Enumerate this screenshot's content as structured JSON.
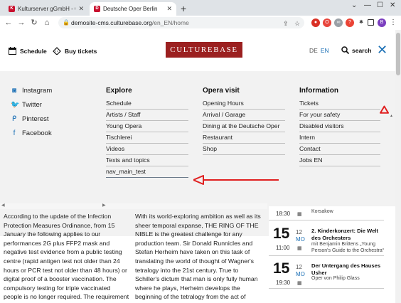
{
  "browser": {
    "tabs": [
      {
        "title": "Kulturserver gGmbH - Culturebas",
        "active": false
      },
      {
        "title": "Deutsche Oper Berlin",
        "active": true
      }
    ],
    "url_host": "demosite-cms.culturebase.org",
    "url_path": "/en_EN/home",
    "profile_initial": "B"
  },
  "header": {
    "schedule": "Schedule",
    "buy_tickets": "Buy tickets",
    "logo": "CULTUREBASE",
    "lang_de": "DE",
    "lang_en": "EN",
    "search": "search"
  },
  "menu": {
    "social": [
      "Instagram",
      "Twitter",
      "Pinterest",
      "Facebook"
    ],
    "explore": {
      "title": "Explore",
      "items": [
        "Schedule",
        "Artists / Staff",
        "Young Opera",
        "Tischlerei",
        "Videos",
        "Texts and topics",
        "nav_main_test"
      ]
    },
    "opera_visit": {
      "title": "Opera visit",
      "items": [
        "Opening Hours",
        "Arrival / Garage",
        "Dining at the Deutsche Oper",
        "Restaurant",
        "Shop"
      ]
    },
    "information": {
      "title": "Information",
      "items": [
        "Tickets",
        "For your safety",
        "Disabled visitors",
        "Intern",
        "Contact",
        "Jobs EN"
      ]
    }
  },
  "content": {
    "left_text": [
      "According to the update of the Infection",
      "Protection Measures Ordinance, from 15",
      "January the following applies to our",
      "performances 2G plus FFP2 mask and",
      "negative test evidence from a public testing",
      "centre (rapid antigen test not older than 24",
      "hours or PCR test not older than 48 hours) or",
      "digital proof of a booster vaccination. The",
      "compulsory testing for triple vaccinated",
      "people is no longer required. The requirement"
    ],
    "mid_text": [
      "With its world-exploring ambition as well as its",
      "sheer temporal expanse, THE RING OF THE",
      "NIBLE is the greatest challenge for any",
      "production team. Sir Donald Runnicles and",
      "Stefan Herheim have taken on this task of",
      "translating the world of thought of Wagner's",
      "tetralogy into the 21st century. True to",
      "Schiller's dictum that man is only fully human",
      "where he plays, Herheim develops the",
      "beginning of the tetralogy from the act of"
    ]
  },
  "events": [
    {
      "day": "",
      "num": "",
      "mon": "",
      "time": "18:30",
      "title": "",
      "sub": "Korsakow"
    },
    {
      "day": "15",
      "num": "12",
      "mon": "MO",
      "time": "11:00",
      "title": "2. Kinderkonzert: Die Welt des Orchesters",
      "sub": "mit Benjamin Brittens „Young Person's Guide to the Orchestra“"
    },
    {
      "day": "15",
      "num": "12",
      "mon": "MO",
      "time": "19:30",
      "title": "Der Untergang des Hauses Usher",
      "sub": "Oper von Philip Glass"
    }
  ],
  "colors": {
    "brand": "#9b2020",
    "accent": "#1a6fb5",
    "annotation": "#e02020"
  }
}
